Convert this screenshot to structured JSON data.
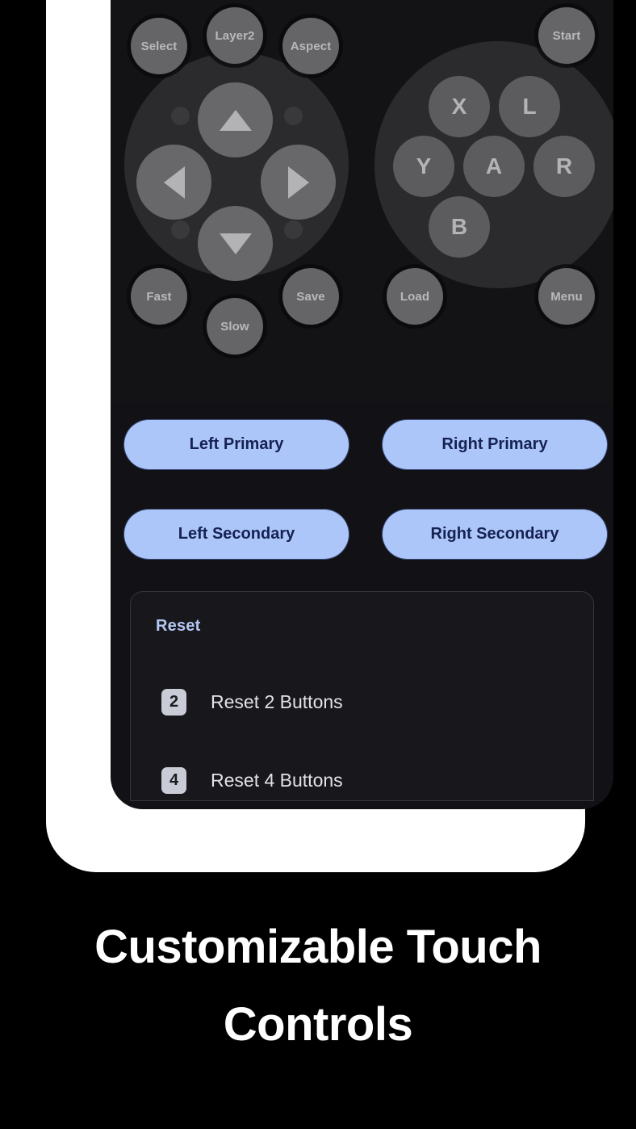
{
  "caption": {
    "line1": "Customizable Touch",
    "line2": "Controls"
  },
  "colors": {
    "screen_bg": "#121216",
    "pad_bg": "#131316",
    "button_fill": "#656568",
    "button_text": "#b9b9bc",
    "cluster_bg": "#2b2b2e",
    "pill_bg": "#adc6fa",
    "pill_text": "#152252",
    "accent_blue": "#b4c6f2",
    "card_bg": "#17171c",
    "card_border": "#35353d",
    "frame_white": "#ffffff",
    "page_bg": "#000000"
  },
  "overlay": {
    "top_buttons": [
      {
        "label": "Select",
        "name": "select"
      },
      {
        "label": "Layer2",
        "name": "layer2"
      },
      {
        "label": "Aspect",
        "name": "aspect"
      },
      {
        "label": "Start",
        "name": "start"
      }
    ],
    "dpad": [
      {
        "icon": "arrow-up-icon",
        "name": "dpad-up"
      },
      {
        "icon": "arrow-left-icon",
        "name": "dpad-left"
      },
      {
        "icon": "arrow-right-icon",
        "name": "dpad-right"
      },
      {
        "icon": "arrow-down-icon",
        "name": "dpad-down"
      }
    ],
    "face_buttons": [
      {
        "label": "X",
        "name": "face-x"
      },
      {
        "label": "L",
        "name": "face-l"
      },
      {
        "label": "Y",
        "name": "face-y"
      },
      {
        "label": "A",
        "name": "face-a"
      },
      {
        "label": "R",
        "name": "face-r"
      },
      {
        "label": "B",
        "name": "face-b"
      }
    ],
    "bottom_buttons": [
      {
        "label": "Fast",
        "name": "fast"
      },
      {
        "label": "Slow",
        "name": "slow"
      },
      {
        "label": "Save",
        "name": "save"
      },
      {
        "label": "Load",
        "name": "load"
      },
      {
        "label": "Menu",
        "name": "menu"
      }
    ]
  },
  "pills": [
    {
      "label": "Left Primary",
      "name": "left-primary"
    },
    {
      "label": "Right Primary",
      "name": "right-primary"
    },
    {
      "label": "Left Secondary",
      "name": "left-secondary"
    },
    {
      "label": "Right Secondary",
      "name": "right-secondary"
    }
  ],
  "reset": {
    "title": "Reset",
    "items": [
      {
        "chip": "2",
        "label": "Reset 2 Buttons"
      },
      {
        "chip": "4",
        "label": "Reset 4 Buttons"
      }
    ]
  }
}
